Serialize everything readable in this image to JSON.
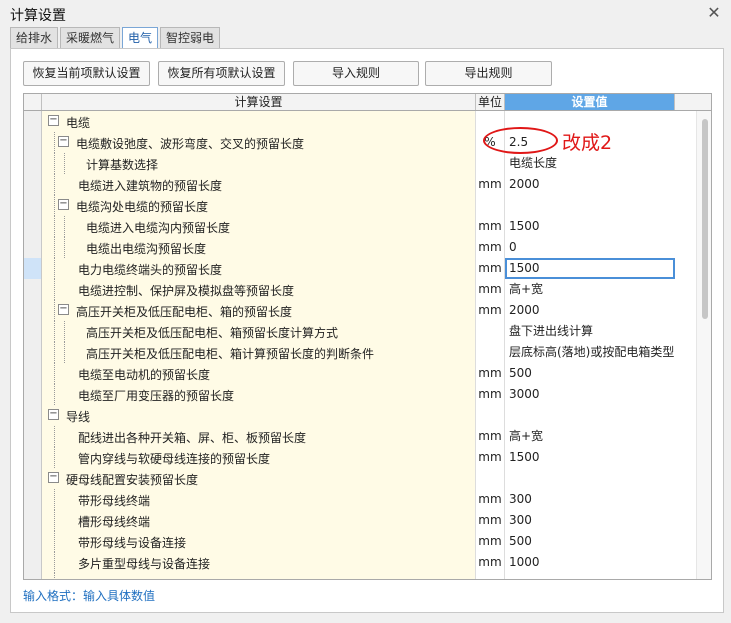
{
  "window": {
    "title": "计算设置"
  },
  "tabs": [
    {
      "label": "给排水",
      "active": false
    },
    {
      "label": "采暖燃气",
      "active": false
    },
    {
      "label": "电气",
      "active": true
    },
    {
      "label": "智控弱电",
      "active": false
    }
  ],
  "toolbar": {
    "restore_current": "恢复当前项默认设置",
    "restore_all": "恢复所有项默认设置",
    "import": "导入规则",
    "export": "导出规则"
  },
  "grid": {
    "headers": {
      "name": "计算设置",
      "unit": "单位",
      "value": "设置值"
    },
    "rows": [
      {
        "level": 0,
        "expand": "−",
        "name": "电缆",
        "unit": "",
        "value": ""
      },
      {
        "level": 1,
        "expand": "−",
        "name": "电缆敷设弛度、波形弯度、交叉的预留长度",
        "unit": "%",
        "value": "2.5"
      },
      {
        "level": 2,
        "name": "计算基数选择",
        "unit": "",
        "value": "电缆长度"
      },
      {
        "level": 1,
        "name": "电缆进入建筑物的预留长度",
        "unit": "mm",
        "value": "2000"
      },
      {
        "level": 1,
        "expand": "−",
        "name": "电缆沟处电缆的预留长度",
        "unit": "",
        "value": ""
      },
      {
        "level": 2,
        "name": "电缆进入电缆沟内预留长度",
        "unit": "mm",
        "value": "1500"
      },
      {
        "level": 2,
        "name": "电缆出电缆沟预留长度",
        "unit": "mm",
        "value": "0"
      },
      {
        "level": 1,
        "name": "电力电缆终端头的预留长度",
        "unit": "mm",
        "value": "1500",
        "selected": true
      },
      {
        "level": 1,
        "name": "电缆进控制、保护屏及模拟盘等预留长度",
        "unit": "mm",
        "value": "高+宽"
      },
      {
        "level": 1,
        "expand": "−",
        "name": "高压开关柜及低压配电柜、箱的预留长度",
        "unit": "mm",
        "value": "2000"
      },
      {
        "level": 2,
        "name": "高压开关柜及低压配电柜、箱预留长度计算方式",
        "unit": "",
        "value": "盘下进出线计算"
      },
      {
        "level": 2,
        "name": "高压开关柜及低压配电柜、箱计算预留长度的判断条件",
        "unit": "",
        "value": "层底标高(落地)或按配电箱类型"
      },
      {
        "level": 1,
        "name": "电缆至电动机的预留长度",
        "unit": "mm",
        "value": "500"
      },
      {
        "level": 1,
        "name": "电缆至厂用变压器的预留长度",
        "unit": "mm",
        "value": "3000"
      },
      {
        "level": 0,
        "expand": "−",
        "name": "导线",
        "unit": "",
        "value": ""
      },
      {
        "level": 1,
        "name": "配线进出各种开关箱、屏、柜、板预留长度",
        "unit": "mm",
        "value": "高+宽"
      },
      {
        "level": 1,
        "name": "管内穿线与软硬母线连接的预留长度",
        "unit": "mm",
        "value": "1500"
      },
      {
        "level": 0,
        "expand": "−",
        "name": "硬母线配置安装预留长度",
        "unit": "",
        "value": ""
      },
      {
        "level": 1,
        "name": "带形母线终端",
        "unit": "mm",
        "value": "300"
      },
      {
        "level": 1,
        "name": "槽形母线终端",
        "unit": "mm",
        "value": "300"
      },
      {
        "level": 1,
        "name": "带形母线与设备连接",
        "unit": "mm",
        "value": "500"
      },
      {
        "level": 1,
        "name": "多片重型母线与设备连接",
        "unit": "mm",
        "value": "1000"
      },
      {
        "level": 1,
        "name": "",
        "unit": "",
        "value": ""
      }
    ]
  },
  "annotation": {
    "text": "改成2",
    "color": "#e01717"
  },
  "hint": "输入格式：输入具体数值",
  "colors": {
    "header_value_bg": "#5fa6e6",
    "name_cell_bg": "#fffbe6",
    "selection": "#4a8fd8"
  }
}
